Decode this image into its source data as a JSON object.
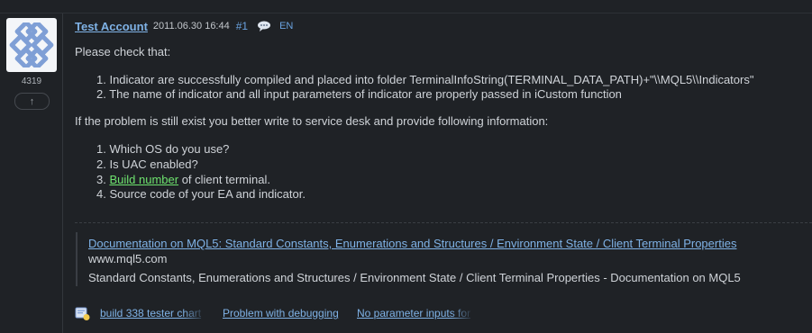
{
  "user": {
    "name": "Test Account",
    "rating": "4319",
    "vote_symbol": "↑"
  },
  "post": {
    "date": "2011.06.30 16:44",
    "number": "#1",
    "language": "EN",
    "intro": "Please check that:",
    "check_items": [
      "1. Indicator are successfully compiled and placed into folder TerminalInfoString(TERMINAL_DATA_PATH)+\"\\\\MQL5\\\\Indicators\"",
      "2. The name of indicator and all input parameters of indicator are properly passed in iCustom function"
    ],
    "problem_text": "If the problem is still exist you better write to service desk and provide following information:",
    "info_items": {
      "i1": "1. Which OS do you use?",
      "i2": "2. Is UAC enabled?",
      "i3_prefix": "3. ",
      "i3_link": "Build number",
      "i3_suffix": " of client terminal.",
      "i4": "4. Source code of your EA and indicator."
    }
  },
  "link_preview": {
    "title": "Documentation on MQL5: Standard Constants, Enumerations and Structures / Environment State / Client Terminal Properties",
    "domain": "www.mql5.com",
    "description": "Standard Constants, Enumerations and Structures / Environment State / Client Terminal Properties - Documentation on MQL5"
  },
  "related_topics": [
    "build 338 tester chart",
    "Problem with debugging",
    "No parameter inputs for"
  ],
  "colors": {
    "background": "#1f2226",
    "link": "#7fb2e6",
    "highlight_link": "#6ee36e",
    "text": "#cfd3d8"
  }
}
